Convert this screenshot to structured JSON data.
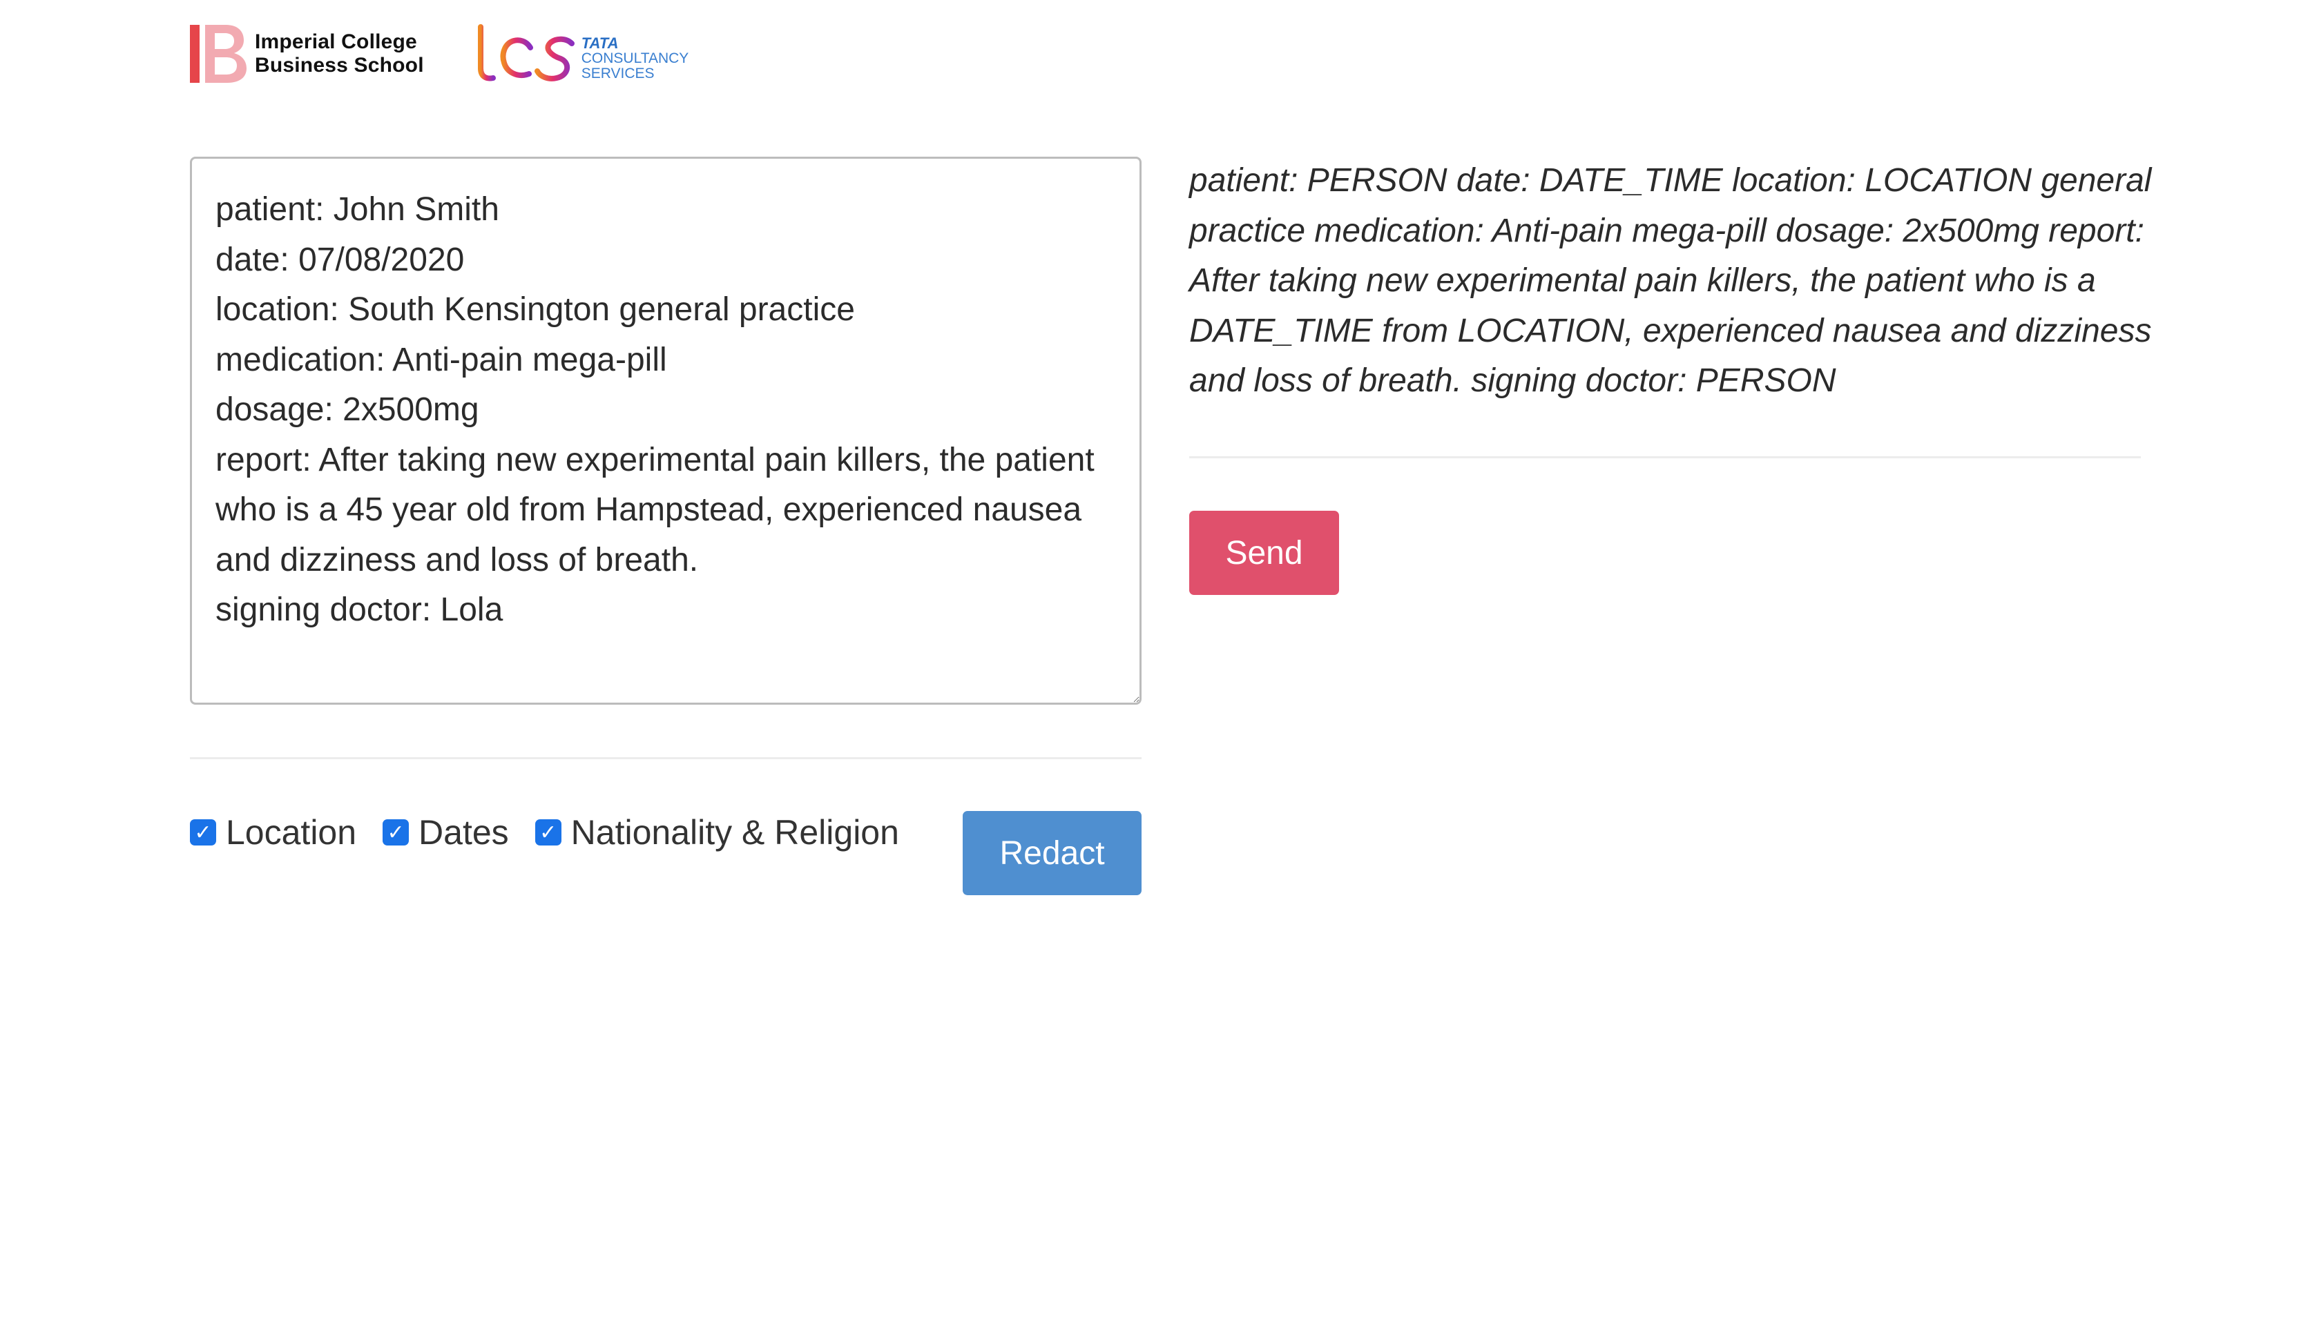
{
  "logos": {
    "icbs": {
      "line1": "Imperial College",
      "line2": "Business School",
      "mark_color": "#e6454a"
    },
    "tcs": {
      "mark": "tcs",
      "line1": "TATA",
      "line2": "CONSULTANCY",
      "line3": "SERVICES",
      "text_color": "#3a7fd0"
    }
  },
  "editor": {
    "value": "patient: John Smith\ndate: 07/08/2020\nlocation: South Kensington general practice\nmedication: Anti-pain mega-pill\ndosage: 2x500mg\nreport: After taking new experimental pain killers, the patient who is a 45 year old from Hampstead, experienced nausea and dizziness and loss of breath.\nsigning doctor: Lola"
  },
  "options": [
    {
      "label": "Location",
      "checked": true
    },
    {
      "label": "Dates",
      "checked": true
    },
    {
      "label": "Nationality & Religion",
      "checked": true
    }
  ],
  "buttons": {
    "redact": "Redact",
    "send": "Send"
  },
  "output": {
    "text": "patient: PERSON date: DATE_TIME location: LOCATION general practice medication: Anti-pain mega-pill dosage: 2x500mg report: After taking new experimental pain killers, the patient who is a DATE_TIME from LOCATION, experienced nausea and dizziness and loss of breath. signing doctor: PERSON"
  },
  "colors": {
    "redact_button": "#4f8fd0",
    "send_button": "#e0506c",
    "checkbox": "#1a73e8"
  }
}
